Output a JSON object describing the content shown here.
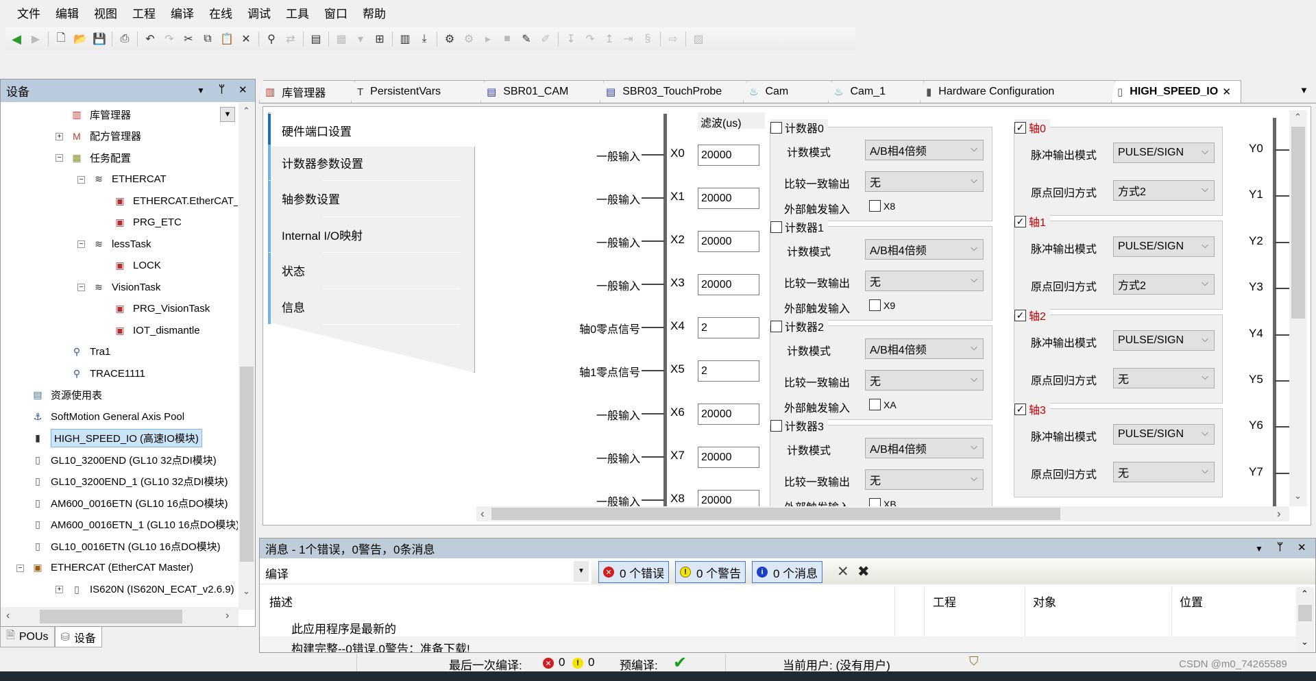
{
  "menu": [
    "文件",
    "编辑",
    "视图",
    "工程",
    "编译",
    "在线",
    "调试",
    "工具",
    "窗口",
    "帮助"
  ],
  "toolbar": [
    "back-icon",
    "forward-icon",
    "sep",
    "new-file-icon",
    "open-folder-icon",
    "save-icon",
    "sep",
    "print-icon",
    "sep",
    "undo-icon",
    "redo-icon",
    "cut-icon",
    "copy-icon",
    "paste-icon",
    "delete-icon",
    "sep",
    "find-icon",
    "replace-icon",
    "sep",
    "clipboard-icon",
    "sep",
    "grid-icon",
    "dropdown-icon",
    "add-object-icon",
    "sep",
    "compile-icon",
    "download-icon",
    "sep",
    "login-icon",
    "logout-icon",
    "run-icon",
    "stop-icon",
    "tools-icon",
    "edit-icon",
    "sep",
    "step-into-icon",
    "step-over-icon",
    "step-out-icon",
    "run-to-cursor-icon",
    "breakpoint-icon",
    "sep",
    "next-icon",
    "sep",
    "disabled-icon"
  ],
  "device_panel": {
    "title": "设备",
    "tree": [
      {
        "label": "库管理器",
        "icon": "library-icon",
        "level": 2
      },
      {
        "label": "配方管理器",
        "icon": "recipe-icon",
        "level": 2,
        "expander": "+"
      },
      {
        "label": "任务配置",
        "icon": "task-config-icon",
        "level": 2,
        "expander": "-"
      },
      {
        "label": "ETHERCAT",
        "icon": "task-icon",
        "level": 3,
        "expander": "-"
      },
      {
        "label": "ETHERCAT.EtherCAT_Task",
        "icon": "program-icon",
        "level": 4
      },
      {
        "label": "PRG_ETC",
        "icon": "program-icon",
        "level": 4
      },
      {
        "label": "lessTask",
        "icon": "task-icon",
        "level": 3,
        "expander": "-"
      },
      {
        "label": "LOCK",
        "icon": "program-icon",
        "level": 4
      },
      {
        "label": "VisionTask",
        "icon": "task-icon",
        "level": 3,
        "expander": "-"
      },
      {
        "label": "PRG_VisionTask",
        "icon": "program-icon",
        "level": 4
      },
      {
        "label": "IOT_dismantle",
        "icon": "program-icon",
        "level": 4
      },
      {
        "label": "Tra1",
        "icon": "trace-icon",
        "level": 2
      },
      {
        "label": "TRACE1111",
        "icon": "trace-icon",
        "level": 2
      },
      {
        "label": "资源使用表",
        "icon": "table-icon",
        "level": 1
      },
      {
        "label": "SoftMotion General Axis Pool",
        "icon": "axis-pool-icon",
        "level": 1
      },
      {
        "label": "HIGH_SPEED_IO (高速IO模块)",
        "icon": "io-module-icon",
        "level": 1,
        "selected": true
      },
      {
        "label": "GL10_3200END (GL10 32点DI模块)",
        "icon": "module-icon",
        "level": 1
      },
      {
        "label": "GL10_3200END_1 (GL10 32点DI模块)",
        "icon": "module-icon",
        "level": 1
      },
      {
        "label": "AM600_0016ETN (GL10 16点DO模块)",
        "icon": "module-icon",
        "level": 1
      },
      {
        "label": "AM600_0016ETN_1 (GL10 16点DO模块)",
        "icon": "module-icon",
        "level": 1
      },
      {
        "label": "GL10_0016ETN (GL10 16点DO模块)",
        "icon": "module-icon",
        "level": 1
      },
      {
        "label": "ETHERCAT (EtherCAT Master)",
        "icon": "ethercat-icon",
        "level": 1,
        "expander": "-"
      },
      {
        "label": "IS620N (IS620N_ECAT_v2.6.9)",
        "icon": "module-icon",
        "level": 2,
        "expander": "+"
      }
    ],
    "bottom_tabs": [
      {
        "label": "POUs",
        "icon": "pou-icon"
      },
      {
        "label": "设备",
        "icon": "devices-icon",
        "active": true
      }
    ]
  },
  "editor_tabs": [
    {
      "label": "库管理器",
      "icon": "library-icon"
    },
    {
      "label": "PersistentVars",
      "icon": "persistent-vars-icon"
    },
    {
      "label": "SBR01_CAM",
      "icon": "document-icon"
    },
    {
      "label": "SBR03_TouchProbe",
      "icon": "document-icon"
    },
    {
      "label": "Cam",
      "icon": "cam-icon"
    },
    {
      "label": "Cam_1",
      "icon": "cam-icon"
    },
    {
      "label": "Hardware Configuration",
      "icon": "hardware-icon"
    },
    {
      "label": "HIGH_SPEED_IO",
      "icon": "module-icon",
      "active": true
    }
  ],
  "nav": [
    "硬件端口设置",
    "计数器参数设置",
    "轴参数设置",
    "Internal I/O映射",
    "状态",
    "信息"
  ],
  "filter_header": "滤波(us)",
  "inputs": [
    {
      "label": "一般输入",
      "name": "X0",
      "filter": "20000"
    },
    {
      "label": "一般输入",
      "name": "X1",
      "filter": "20000"
    },
    {
      "label": "一般输入",
      "name": "X2",
      "filter": "20000"
    },
    {
      "label": "一般输入",
      "name": "X3",
      "filter": "20000"
    },
    {
      "label": "轴0零点信号",
      "name": "X4",
      "filter": "2"
    },
    {
      "label": "轴1零点信号",
      "name": "X5",
      "filter": "2"
    },
    {
      "label": "一般输入",
      "name": "X6",
      "filter": "20000"
    },
    {
      "label": "一般输入",
      "name": "X7",
      "filter": "20000"
    },
    {
      "label": "一般输入",
      "name": "X8",
      "filter": "20000"
    }
  ],
  "counter_labels": {
    "mode": "计数模式",
    "compare": "比较一致输出",
    "trigger": "外部触发输入"
  },
  "counters": [
    {
      "title": "计数器0",
      "checked": false,
      "mode": "A/B相4倍频",
      "compare": "无",
      "trigger_checked": false,
      "trigger_input": "X8"
    },
    {
      "title": "计数器1",
      "checked": false,
      "mode": "A/B相4倍频",
      "compare": "无",
      "trigger_checked": false,
      "trigger_input": "X9"
    },
    {
      "title": "计数器2",
      "checked": false,
      "mode": "A/B相4倍频",
      "compare": "无",
      "trigger_checked": false,
      "trigger_input": "XA"
    },
    {
      "title": "计数器3",
      "checked": false,
      "mode": "A/B相4倍频",
      "compare": "无",
      "trigger_checked": false,
      "trigger_input": "XB"
    }
  ],
  "axis_labels": {
    "pulse": "脉冲输出模式",
    "home": "原点回归方式"
  },
  "axes": [
    {
      "title": "轴0",
      "checked": true,
      "pulse": "PULSE/SIGN",
      "home": "方式2"
    },
    {
      "title": "轴1",
      "checked": true,
      "pulse": "PULSE/SIGN",
      "home": "方式2"
    },
    {
      "title": "轴2",
      "checked": true,
      "pulse": "PULSE/SIGN",
      "home": "无"
    },
    {
      "title": "轴3",
      "checked": true,
      "pulse": "PULSE/SIGN",
      "home": "无"
    }
  ],
  "outputs": [
    "Y0",
    "Y1",
    "Y2",
    "Y3",
    "Y4",
    "Y5",
    "Y6",
    "Y7"
  ],
  "messages": {
    "title": "消息 - 1个错误，0警告，0条消息",
    "source": "编译",
    "errors": "0 个错误",
    "warnings": "0 个警告",
    "infos": "0 个消息",
    "columns": [
      "描述",
      "工程",
      "对象",
      "位置"
    ],
    "rows": [
      "此应用程序是最新的",
      "构建完整--0错误,0警告：准备下载!"
    ]
  },
  "status": {
    "last_build_label": "最后一次编译:",
    "errors": "0",
    "warnings": "0",
    "precompile_label": "预编译:",
    "user_label": "当前用户: (没有用户)"
  },
  "watermark": "CSDN @m0_74265589",
  "colors": {
    "panel_header": "#b9cbdc",
    "axis_title": "#c00000",
    "selected": "#cce4f7"
  }
}
